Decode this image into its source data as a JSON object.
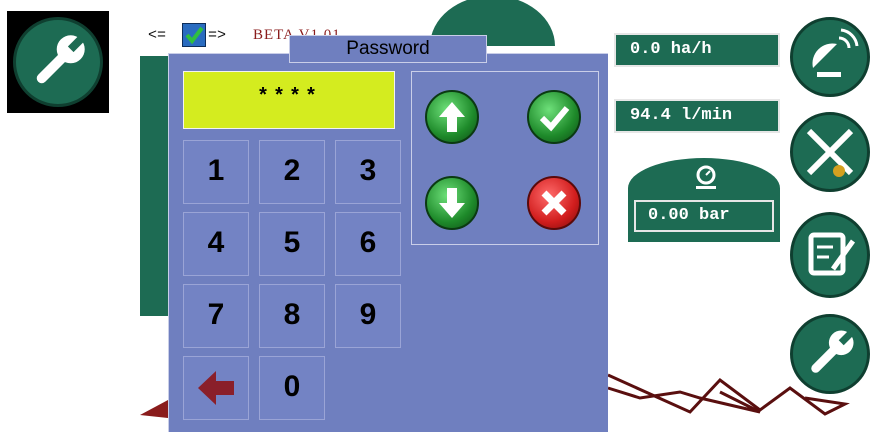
{
  "top": {
    "nav_left": "<=",
    "nav_right": "=>",
    "version": "BETA V1.01"
  },
  "readouts": {
    "rate": "0.0 ha/h",
    "flow": "94.4 l/min",
    "pressure": "0.00 bar"
  },
  "dialog": {
    "title": "Password",
    "masked_value": "****",
    "keys": [
      "1",
      "2",
      "3",
      "4",
      "5",
      "6",
      "7",
      "8",
      "9"
    ],
    "zero_key": "0"
  },
  "icons": {
    "top_left": "wrench-icon",
    "side": [
      "satellite-dish-icon",
      "ruler-pencil-icon",
      "notepad-icon",
      "wrench-icon"
    ],
    "pressure": "gauge-icon",
    "dialog": [
      "arrow-up-icon",
      "check-icon",
      "arrow-down-icon",
      "cross-icon",
      "backspace-arrow-icon"
    ]
  },
  "colors": {
    "brand_green": "#1d6b53",
    "dialog_bg": "#6f7fbf",
    "display_bg": "#d4ec1f",
    "accent_red": "#8a1c1c"
  }
}
